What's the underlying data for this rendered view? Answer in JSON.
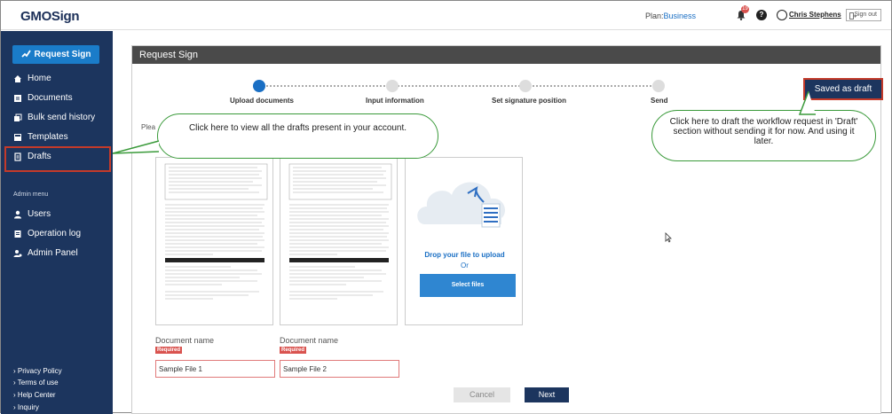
{
  "header": {
    "logo": "GMOSign",
    "plan_label": "Plan:",
    "plan_value": "Business",
    "notification_count": "19",
    "help_label": "?",
    "user_name": "Chris Stephens",
    "signout_label": "Sign out"
  },
  "sidebar": {
    "request_button": "Request Sign",
    "items": [
      {
        "label": "Home",
        "icon": "home-icon"
      },
      {
        "label": "Documents",
        "icon": "document-icon"
      },
      {
        "label": "Bulk send history",
        "icon": "bulk-send-icon"
      },
      {
        "label": "Templates",
        "icon": "template-icon"
      },
      {
        "label": "Drafts",
        "icon": "draft-icon"
      }
    ],
    "admin_label": "Admin menu",
    "admin_items": [
      {
        "label": "Users",
        "icon": "user-icon"
      },
      {
        "label": "Operation log",
        "icon": "log-icon"
      },
      {
        "label": "Admin Panel",
        "icon": "admin-icon"
      }
    ],
    "footer_links": [
      "› Privacy Policy",
      "› Terms of use",
      "› Help Center",
      "› Inquiry"
    ]
  },
  "main": {
    "title": "Request Sign",
    "steps": [
      "Upload documents",
      "Input information",
      "Set signature position",
      "Send"
    ],
    "active_step": 0,
    "saved_draft_button": "Saved as draft",
    "please_text": "Plea",
    "documents": [
      {
        "label": "Document name",
        "required": "Required",
        "value": "Sample File 1"
      },
      {
        "label": "Document name",
        "required": "Required",
        "value": "Sample File 2"
      }
    ],
    "upload": {
      "drop_text": "Drop your file to upload",
      "or_text": "Or",
      "select_button": "Select files"
    },
    "cancel_button": "Cancel",
    "next_button": "Next"
  },
  "callouts": {
    "left": "Click here to view all the drafts present in your account.",
    "right": "Click here to draft the workflow request in 'Draft' section without sending it for now. And using it later."
  },
  "colors": {
    "sidebar_bg": "#1c355e",
    "accent": "#1a7cc9",
    "highlight_border": "#c43a2a",
    "callout_border": "#3a9a3a"
  }
}
